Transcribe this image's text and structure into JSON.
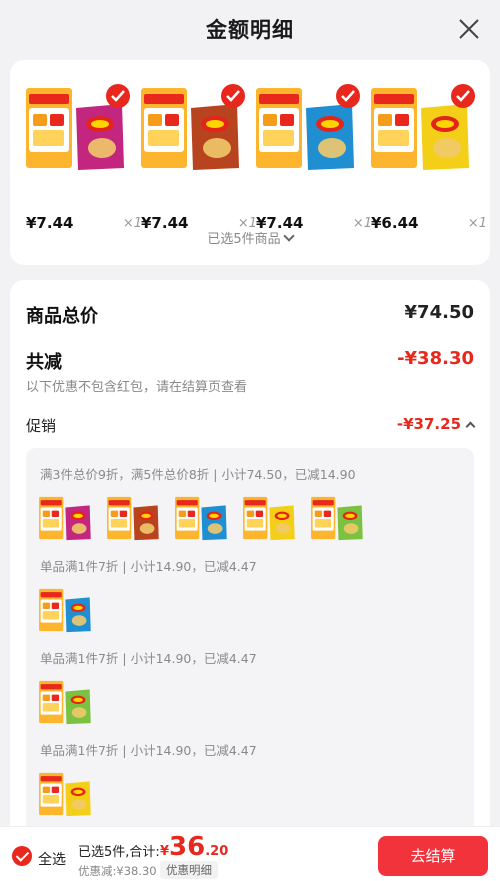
{
  "header": {
    "title": "金额明细"
  },
  "products": [
    {
      "price": "¥7.44",
      "qty": "×1",
      "bag_color": "#c2267e",
      "bag_icon": "chips-bag-icon"
    },
    {
      "price": "¥7.44",
      "qty": "×1",
      "bag_color": "#b8431f",
      "bag_icon": "chips-bag-icon"
    },
    {
      "price": "¥7.44",
      "qty": "×1",
      "bag_color": "#1f8fd1",
      "bag_icon": "chips-bag-icon"
    },
    {
      "price": "¥6.44",
      "qty": "×1",
      "bag_color": "#f3cf18",
      "bag_icon": "chips-bag-icon"
    }
  ],
  "selected_toggle": "已选5件商品",
  "summary": {
    "goods_total_label": "商品总价",
    "goods_total_value": "¥74.50",
    "discount_label": "共减",
    "discount_value": "-¥38.30",
    "discount_note": "以下优惠不包含红包，请在结算页查看",
    "promo_label": "促销",
    "promo_value": "-¥37.25"
  },
  "promo_groups": [
    {
      "text": "满3件总价9折，满5件总价8折 | 小计74.50，已减14.90"
    },
    {
      "text": "单品满1件7折 | 小计14.90，已减4.47"
    },
    {
      "text": "单品满1件7折 | 小计14.90，已减4.47"
    },
    {
      "text": "单品满1件7折 | 小计14.90，已减4.47"
    }
  ],
  "bottom": {
    "select_all": "全选",
    "total_prefix": "已选5件,合计:",
    "total_currency": "¥",
    "total_int": "36",
    "total_dec": ".20",
    "discounted": "优惠减:¥38.30",
    "detail": "优惠明细",
    "checkout": "去结算"
  },
  "colors": {
    "accent": "#e8271d",
    "button": "#f2333b"
  }
}
